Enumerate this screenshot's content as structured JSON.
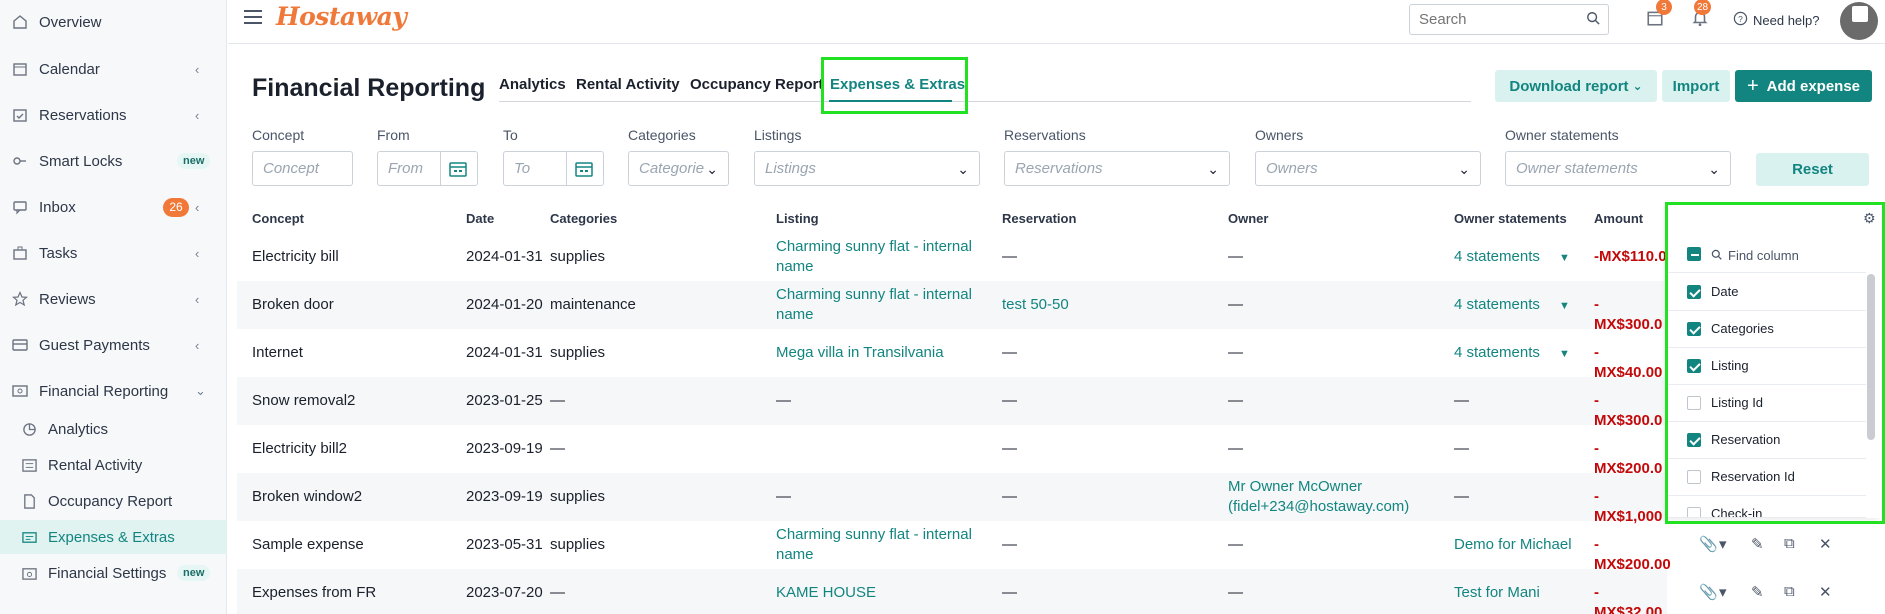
{
  "sidebar": {
    "items": [
      {
        "label": "Overview",
        "icon": "home-icon"
      },
      {
        "label": "Calendar",
        "icon": "calendar-icon"
      },
      {
        "label": "Reservations",
        "icon": "calendar-check-icon"
      },
      {
        "label": "Smart Locks",
        "icon": "key-icon",
        "badge": "new"
      },
      {
        "label": "Inbox",
        "icon": "chat-icon",
        "count": "26"
      },
      {
        "label": "Tasks",
        "icon": "briefcase-icon"
      },
      {
        "label": "Reviews",
        "icon": "star-icon"
      },
      {
        "label": "Guest Payments",
        "icon": "credit-card-icon"
      },
      {
        "label": "Financial Reporting",
        "icon": "money-icon"
      }
    ],
    "sub_items": [
      {
        "label": "Analytics",
        "icon": "pie-chart-icon"
      },
      {
        "label": "Rental Activity",
        "icon": "list-icon"
      },
      {
        "label": "Occupancy Report",
        "icon": "document-icon"
      },
      {
        "label": "Expenses & Extras",
        "icon": "receipt-icon"
      },
      {
        "label": "Financial Settings",
        "icon": "settings-icon",
        "badge": "new"
      }
    ]
  },
  "topbar": {
    "logo": "Hostaway",
    "search_placeholder": "Search",
    "calendar_badge": "3",
    "bell_badge": "28",
    "help_label": "Need help?"
  },
  "header": {
    "title": "Financial Reporting",
    "tabs": [
      "Analytics",
      "Rental Activity",
      "Occupancy Report",
      "Expenses & Extras"
    ],
    "download_label": "Download report",
    "import_label": "Import",
    "add_label": "Add expense"
  },
  "filters": {
    "concept": {
      "label": "Concept",
      "placeholder": "Concept"
    },
    "from": {
      "label": "From",
      "placeholder": "From"
    },
    "to": {
      "label": "To",
      "placeholder": "To"
    },
    "categories": {
      "label": "Categories",
      "placeholder": "Categorie"
    },
    "listings": {
      "label": "Listings",
      "placeholder": "Listings"
    },
    "reservations": {
      "label": "Reservations",
      "placeholder": "Reservations"
    },
    "owners": {
      "label": "Owners",
      "placeholder": "Owners"
    },
    "owner_statements": {
      "label": "Owner statements",
      "placeholder": "Owner statements"
    },
    "reset_label": "Reset"
  },
  "table": {
    "headers": [
      "Concept",
      "Date",
      "Categories",
      "Listing",
      "Reservation",
      "Owner",
      "Owner statements",
      "Amount"
    ],
    "rows": [
      {
        "concept": "Electricity bill",
        "date": "2024-01-31",
        "category": "supplies",
        "listing_1": "Charming sunny flat - internal",
        "listing_2": "name",
        "reservation": "—",
        "owner_1": "—",
        "owner_2": "",
        "statements": "4 statements",
        "amount": "-MX$110.0"
      },
      {
        "concept": "Broken door",
        "date": "2024-01-20",
        "category": "maintenance",
        "listing_1": "Charming sunny flat - internal",
        "listing_2": "name",
        "reservation": "test 50-50",
        "owner_1": "—",
        "owner_2": "",
        "statements": "4 statements",
        "amount": "-MX$300.0"
      },
      {
        "concept": "Internet",
        "date": "2024-01-31",
        "category": "supplies",
        "listing_1": "Mega villa in Transilvania",
        "listing_2": "",
        "reservation": "—",
        "owner_1": "—",
        "owner_2": "",
        "statements": "4 statements",
        "amount": "-MX$40.00"
      },
      {
        "concept": "Snow removal2",
        "date": "2023-01-25",
        "category": "—",
        "listing_1": "—",
        "listing_2": "",
        "reservation": "—",
        "owner_1": "—",
        "owner_2": "",
        "statements": "—",
        "amount": "-MX$300.0"
      },
      {
        "concept": "Electricity bill2",
        "date": "2023-09-19",
        "category": "—",
        "listing_1": "",
        "listing_2": "",
        "reservation": "—",
        "owner_1": "—",
        "owner_2": "",
        "statements": "—",
        "amount": "-MX$200.0"
      },
      {
        "concept": "Broken window2",
        "date": "2023-09-19",
        "category": "supplies",
        "listing_1": "—",
        "listing_2": "",
        "reservation": "—",
        "owner_1": "Mr Owner McOwner",
        "owner_2": "(fidel+234@hostaway.com)",
        "statements": "—",
        "amount": "-MX$1,000"
      },
      {
        "concept": "Sample expense",
        "date": "2023-05-31",
        "category": "supplies",
        "listing_1": "Charming sunny flat - internal",
        "listing_2": "name",
        "reservation": "—",
        "owner_1": "—",
        "owner_2": "",
        "statements": "Demo for Michael",
        "amount": "-MX$200.00"
      },
      {
        "concept": "Expenses from FR",
        "date": "2023-07-20",
        "category": "—",
        "listing_1": "KAME HOUSE",
        "listing_2": "",
        "reservation": "—",
        "owner_1": "—",
        "owner_2": "",
        "statements": "Test for Mani",
        "amount": "-MX$32.00"
      }
    ]
  },
  "column_picker": {
    "search_placeholder": "Find column",
    "options": [
      {
        "label": "Date",
        "checked": true
      },
      {
        "label": "Categories",
        "checked": true
      },
      {
        "label": "Listing",
        "checked": true
      },
      {
        "label": "Listing Id",
        "checked": false
      },
      {
        "label": "Reservation",
        "checked": true
      },
      {
        "label": "Reservation Id",
        "checked": false
      },
      {
        "label": "Check-in",
        "checked": false
      }
    ]
  },
  "colors": {
    "accent": "#138580",
    "brand": "#f0793a",
    "negative": "#c20a0a",
    "highlight": "#22e022"
  }
}
